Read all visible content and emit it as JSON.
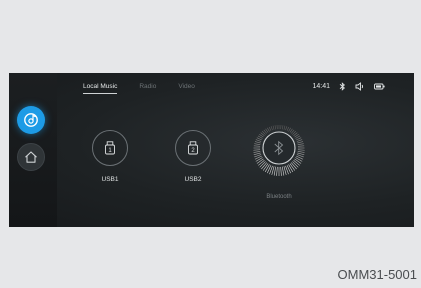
{
  "tabs": [
    {
      "label": "Local Music",
      "active": true
    },
    {
      "label": "Radio",
      "active": false
    },
    {
      "label": "Video",
      "active": false
    }
  ],
  "status": {
    "time": "14:41",
    "icons": [
      "bluetooth-icon",
      "volume-icon",
      "battery-icon"
    ]
  },
  "side": {
    "buttons": [
      {
        "icon": "music-disc-icon",
        "active": true
      },
      {
        "icon": "home-icon",
        "active": false
      }
    ]
  },
  "sources": [
    {
      "label": "USB1",
      "badge": "1",
      "icon": "usb-drive-icon"
    },
    {
      "label": "USB2",
      "badge": "2",
      "icon": "usb-drive-icon"
    },
    {
      "label": "Bluetooth",
      "icon": "bluetooth-icon"
    }
  ],
  "figure_code": "OMM31-5001",
  "colors": {
    "accent": "#1d9be6",
    "screen_bg": "#1e2224",
    "page_bg": "#e6e7e9"
  }
}
